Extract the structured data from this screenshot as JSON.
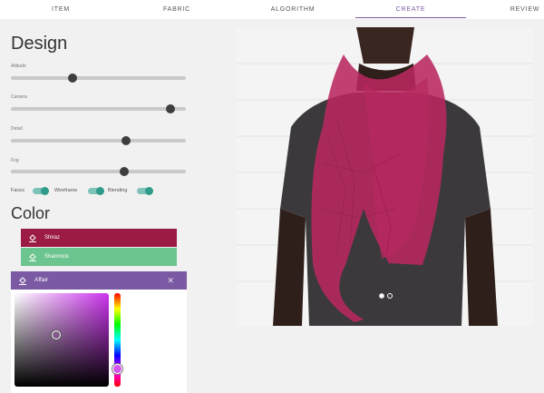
{
  "tabs": [
    {
      "label": "ITEM"
    },
    {
      "label": "FABRIC"
    },
    {
      "label": "ALGORITHM"
    },
    {
      "label": "CREATE",
      "active": true
    },
    {
      "label": "REVIEW"
    }
  ],
  "design": {
    "title": "Design",
    "sliders": [
      {
        "label": "Altitude",
        "value": 0.35
      },
      {
        "label": "Camera",
        "value": 0.91
      },
      {
        "label": "Detail",
        "value": 0.66
      },
      {
        "label": "Fog",
        "value": 0.65
      }
    ],
    "toggles": [
      {
        "label": "Faces",
        "on": true
      },
      {
        "label": "Wireframe",
        "on": true
      },
      {
        "label": "Blending",
        "on": true
      }
    ]
  },
  "color": {
    "title": "Color",
    "swatches": [
      {
        "name": "Shiraz",
        "color": "#9b1b44"
      },
      {
        "name": "Shamrock",
        "color": "#6cc48e"
      }
    ],
    "picker": {
      "name": "Affair",
      "color": "#7b5aa3",
      "close_icon": "close-icon",
      "hue_color": "#cc33ee"
    }
  },
  "preview": {
    "scarf_color": "#b8285f",
    "carousel_total": 2,
    "carousel_active": 1
  }
}
